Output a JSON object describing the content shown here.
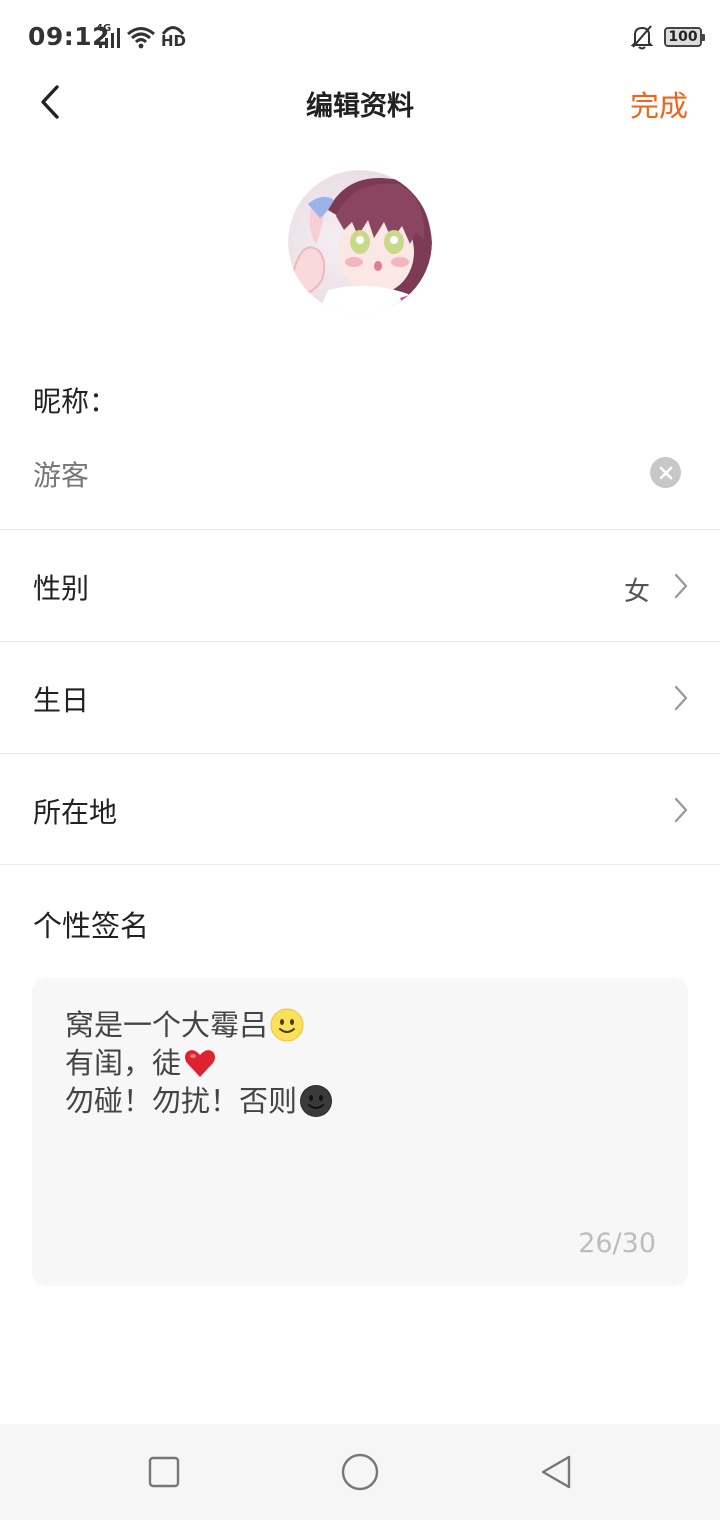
{
  "status_bar": {
    "time": "09:12",
    "network": "4G",
    "hd": "HD",
    "battery": "100"
  },
  "header": {
    "title": "编辑资料",
    "done_label": "完成",
    "accent_color": "#f0651a"
  },
  "profile": {
    "avatar_icon": "anime-girl-avatar",
    "nickname_label": "昵称：",
    "nickname_value": "游客"
  },
  "rows": [
    {
      "label": "性别",
      "value": "女"
    },
    {
      "label": "生日",
      "value": ""
    },
    {
      "label": "所在地",
      "value": ""
    }
  ],
  "signature": {
    "label": "个性签名",
    "lines": [
      "窝是一个大霉吕",
      "有闺，徒",
      "勿碰！勿扰！否则"
    ],
    "line_emojis": [
      "smiley-emoji",
      "red-heart-emoji",
      "dark-smiley-emoji"
    ],
    "counter": "26/30"
  },
  "nav_bar": {
    "icons": [
      "recent-apps-icon",
      "home-icon",
      "back-triangle-icon"
    ]
  }
}
